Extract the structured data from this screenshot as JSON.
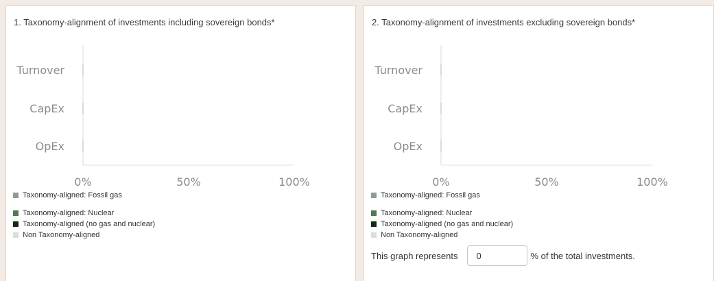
{
  "colors": {
    "fossil_gas": "#8b9e8e",
    "nuclear": "#4f7a4f",
    "no_gas_nuclear": "#0f2c12",
    "non_aligned": "#dcdcdc"
  },
  "chart_data": [
    {
      "type": "bar",
      "orientation": "horizontal",
      "stacked": true,
      "title": "1. Taxonomy-alignment of investments including sovereign bonds*",
      "categories": [
        "Turnover",
        "CapEx",
        "OpEx"
      ],
      "x_ticks": [
        "0%",
        "50%",
        "100%"
      ],
      "xlim": [
        0,
        100
      ],
      "series": [
        {
          "name": "Taxonomy-aligned: Fossil gas",
          "values": [
            0,
            0,
            0
          ]
        },
        {
          "name": "Taxonomy-aligned: Nuclear",
          "values": [
            0,
            0,
            0
          ]
        },
        {
          "name": "Taxonomy-aligned (no gas and nuclear)",
          "values": [
            0,
            0,
            0
          ]
        },
        {
          "name": "Non Taxonomy-aligned",
          "values": [
            0,
            0,
            0
          ]
        }
      ],
      "legend_placement": "bottom-left"
    },
    {
      "type": "bar",
      "orientation": "horizontal",
      "stacked": true,
      "title": "2. Taxonomy-alignment of investments excluding sovereign bonds*",
      "categories": [
        "Turnover",
        "CapEx",
        "OpEx"
      ],
      "x_ticks": [
        "0%",
        "50%",
        "100%"
      ],
      "xlim": [
        0,
        100
      ],
      "series": [
        {
          "name": "Taxonomy-aligned: Fossil gas",
          "values": [
            0,
            0,
            0
          ]
        },
        {
          "name": "Taxonomy-aligned: Nuclear",
          "values": [
            0,
            0,
            0
          ]
        },
        {
          "name": "Taxonomy-aligned (no gas and nuclear)",
          "values": [
            0,
            0,
            0
          ]
        },
        {
          "name": "Non Taxonomy-aligned",
          "values": [
            0,
            0,
            0
          ]
        }
      ],
      "legend_placement": "bottom-left"
    }
  ],
  "legend_labels": [
    "Taxonomy-aligned: Fossil gas",
    "Taxonomy-aligned: Nuclear",
    "Taxonomy-aligned (no gas and nuclear)",
    "Non Taxonomy-aligned"
  ],
  "note": {
    "prefix": "This graph represents",
    "value": "0",
    "suffix": "% of the total investments."
  }
}
